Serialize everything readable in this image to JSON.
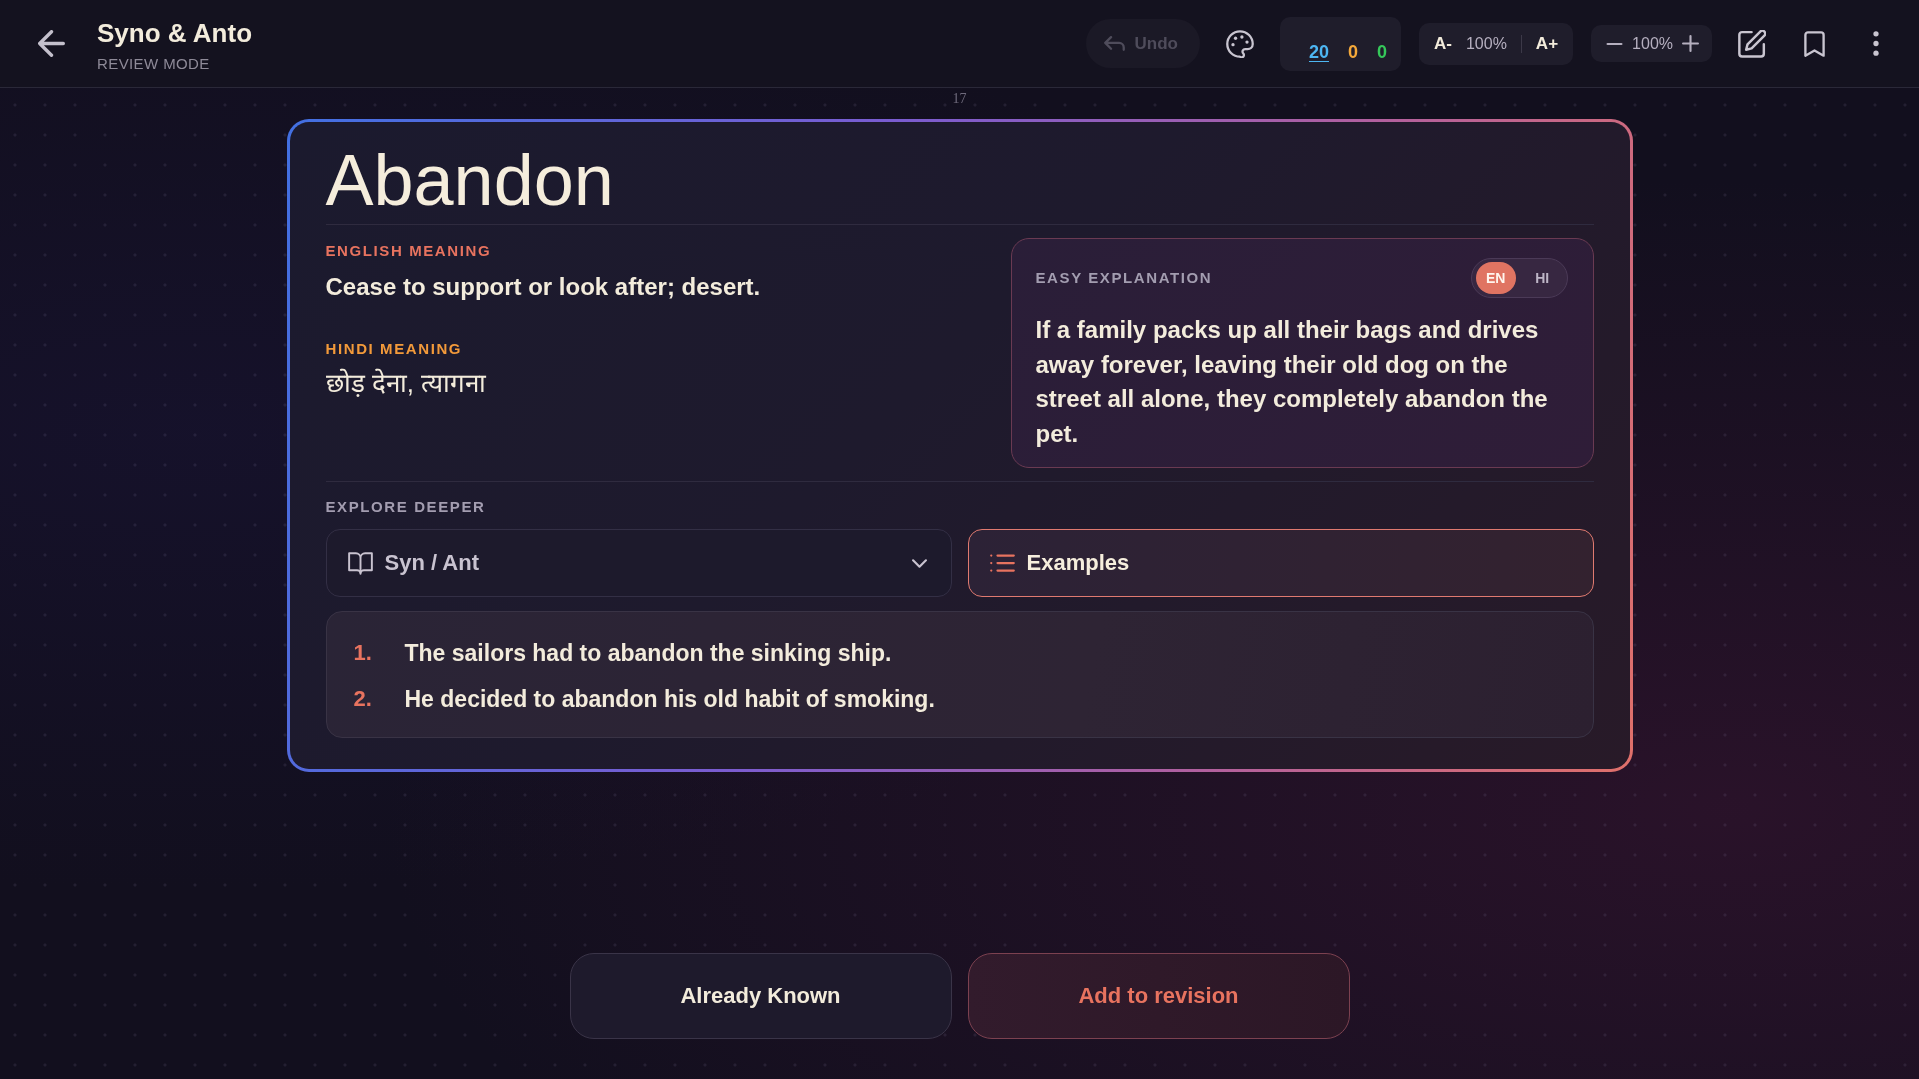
{
  "header": {
    "title": "Syno & Anto",
    "subtitle": "REVIEW MODE"
  },
  "toolbar": {
    "undo": {
      "label": "Undo",
      "disabled": true
    },
    "counters": [
      {
        "value": "20",
        "color": "#4db6f2",
        "selected": true
      },
      {
        "value": "0",
        "color": "#f5a93a",
        "selected": false
      },
      {
        "value": "0",
        "color": "#35c85a",
        "selected": false
      }
    ],
    "font_size": {
      "decrease": "A-",
      "reading": "100%",
      "increase": "A+"
    },
    "zoom": {
      "reading": "100%"
    }
  },
  "card_number": "17",
  "card": {
    "word": "Abandon",
    "english_meaning": {
      "label": "ENGLISH MEANING",
      "text": "Cease to support or look after; desert."
    },
    "hindi_meaning": {
      "label": "HINDI MEANING",
      "text": "छोड़ देना, त्यागना"
    },
    "easy_explanation": {
      "label": "EASY EXPLANATION",
      "languages": [
        {
          "label": "EN",
          "selected": true
        },
        {
          "label": "HI",
          "selected": false
        }
      ],
      "text": "If a family packs up all their bags and drives away forever, leaving their old dog on the street all alone, they completely abandon the pet."
    },
    "explore": {
      "label": "EXPLORE DEEPER",
      "tabs": [
        {
          "label": "Syn / Ant",
          "kind": "synonyms",
          "selected": false
        },
        {
          "label": "Examples",
          "kind": "examples",
          "selected": true
        }
      ],
      "examples": [
        {
          "number": "1.",
          "text": "The sailors had to abandon the sinking ship."
        },
        {
          "number": "2.",
          "text": "He decided to abandon his old habit of smoking."
        }
      ]
    }
  },
  "actions": [
    {
      "label": "Already Known",
      "kind": "secondary"
    },
    {
      "label": "Add to revision",
      "kind": "primary"
    }
  ]
}
